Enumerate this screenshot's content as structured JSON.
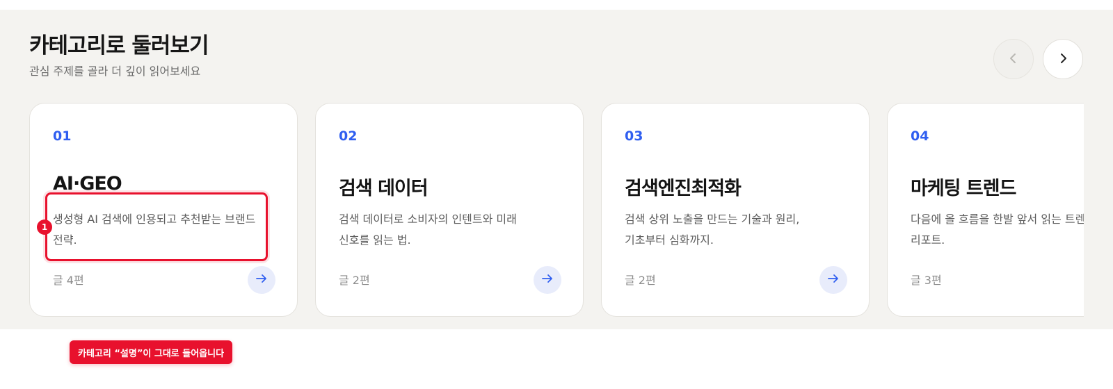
{
  "section": {
    "title": "카테고리로 둘러보기",
    "subtitle": "관심 주제를 골라 더 깊이 읽어보세요"
  },
  "nav": {
    "prev_icon": "chevron-left-icon",
    "next_icon": "chevron-right-icon"
  },
  "cards": [
    {
      "number": "01",
      "title": "AI·GEO",
      "description_line1": "생성형 AI 검색에 인용되고 추천받는 브랜드",
      "description_line2": "전략.",
      "count": "글 4편"
    },
    {
      "number": "02",
      "title": "검색 데이터",
      "description_line1": "검색 데이터로 소비자의 인텐트와 미래",
      "description_line2": "신호를 읽는 법.",
      "count": "글 2편"
    },
    {
      "number": "03",
      "title": "검색엔진최적화",
      "description_line1": "검색 상위 노출을 만드는 기술과 원리,",
      "description_line2": "기초부터 심화까지.",
      "count": "글 2편"
    },
    {
      "number": "04",
      "title": "마케팅 트렌드",
      "description_line1": "다음에 올 흐름을 한발 앞서 읽는 트렌드",
      "description_line2": "리포트.",
      "count": "글 3편"
    }
  ],
  "annotation": {
    "marker": "1",
    "tooltip": "카테고리 “설명”이 그대로 들어옵니다"
  },
  "colors": {
    "accent": "#2f5ef0",
    "highlight": "#e8112d",
    "section_bg": "#f4f3f0"
  }
}
